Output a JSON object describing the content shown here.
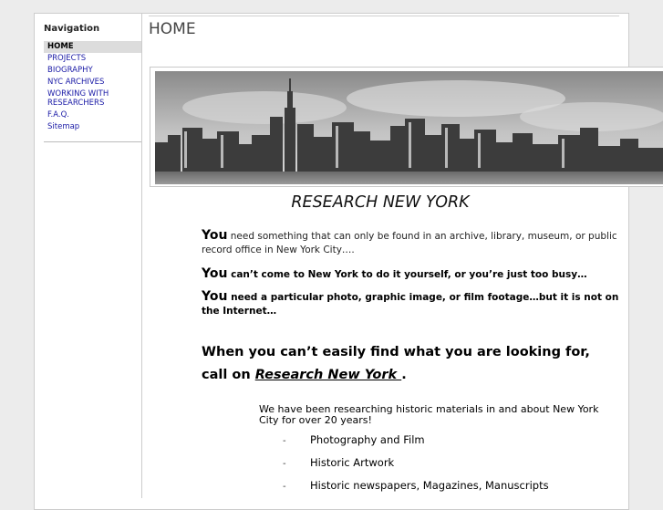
{
  "nav": {
    "heading": "Navigation",
    "items": [
      {
        "label": "HOME",
        "active": true
      },
      {
        "label": "PROJECTS",
        "active": false
      },
      {
        "label": "BIOGRAPHY",
        "active": false
      },
      {
        "label": "NYC ARCHIVES",
        "active": false
      },
      {
        "label": "WORKING WITH RESEARCHERS",
        "active": false
      },
      {
        "label": "F.A.Q.",
        "active": false
      },
      {
        "label": "Sitemap",
        "active": false
      }
    ]
  },
  "page": {
    "title": "HOME",
    "headline": "RESEARCH NEW YORK"
  },
  "you_items": [
    {
      "you": "You",
      "text": "  need something that can only be found in an archive, library, museum, or public record office in  New York City…."
    },
    {
      "you": "You",
      "text": "  can’t come to New York to do it yourself, or you’re just too busy…"
    },
    {
      "you": "You",
      "text": " need a particular photo,  graphic image, or film footage…but it is not on the Internet…"
    }
  ],
  "callout": {
    "line1": "When you can’t easily find what you are looking for,",
    "prefix": "call on ",
    "link": "Research New York ",
    "suffix": "."
  },
  "intro": "We have been researching historic materials in and about New York City for over 20 years!",
  "services": [
    {
      "dash": "-",
      "label": "Photography and Film"
    },
    {
      "dash": "-",
      "label": "Historic Artwork"
    },
    {
      "dash": "-",
      "label": "Historic newspapers, Magazines, Manuscripts"
    }
  ],
  "colors": {
    "nav_link": "#1a1aa6",
    "nav_active_bg": "#dcdcdc",
    "page_bg": "#ececec"
  }
}
